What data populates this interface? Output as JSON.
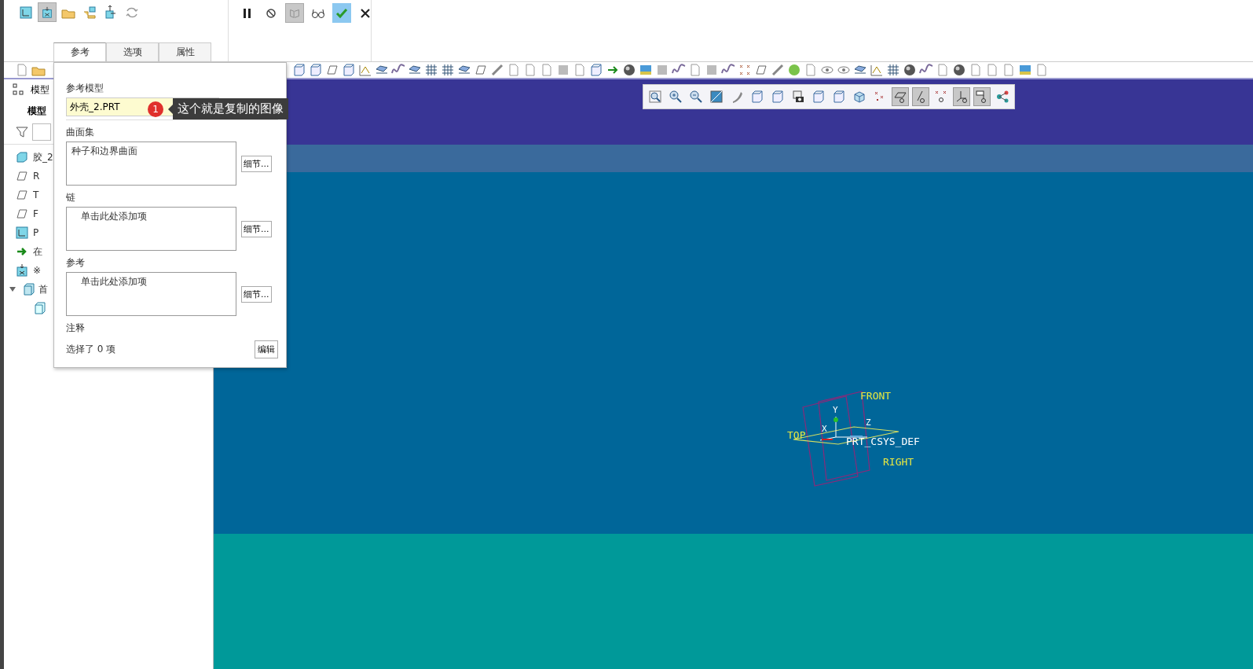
{
  "ribbon": {
    "left_buttons": [
      {
        "kind": "csys",
        "pressed": false
      },
      {
        "kind": "copy",
        "pressed": true
      },
      {
        "kind": "open",
        "pressed": false
      },
      {
        "kind": "import",
        "pressed": false
      },
      {
        "kind": "move",
        "pressed": false
      },
      {
        "kind": "swap",
        "pressed": false
      }
    ],
    "right_buttons": [
      {
        "kind": "pause",
        "pressed": false
      },
      {
        "kind": "cancel",
        "pressed": false
      },
      {
        "kind": "preview",
        "pressed": true
      },
      {
        "kind": "glasses",
        "pressed": false
      },
      {
        "kind": "ok",
        "pressed": true
      },
      {
        "kind": "close",
        "pressed": false
      }
    ],
    "tabs": [
      {
        "label": "参考",
        "selected": true
      },
      {
        "label": "选项",
        "selected": false
      },
      {
        "label": "属性",
        "selected": false
      }
    ]
  },
  "model_tree": {
    "header": "模型",
    "tab": "模型",
    "items": [
      {
        "kind": "part",
        "label": "胶_2"
      },
      {
        "kind": "plane",
        "label": "R"
      },
      {
        "kind": "plane",
        "label": "T"
      },
      {
        "kind": "plane",
        "label": "F"
      },
      {
        "kind": "csys",
        "label": "P"
      },
      {
        "kind": "insert",
        "label": "在"
      },
      {
        "kind": "copy",
        "label": "※"
      },
      {
        "kind": "feature",
        "label": "首",
        "expanded": true,
        "children": [
          {
            "kind": "quilt"
          }
        ]
      }
    ]
  },
  "reference_panel": {
    "model_label": "参考模型",
    "model_value": "外壳_2.PRT",
    "sections": [
      {
        "label": "曲面集",
        "items": [
          "种子和边界曲面"
        ],
        "button": "细节..."
      },
      {
        "label": "链",
        "placeholder": "单击此处添加项",
        "button": "细节..."
      },
      {
        "label": "参考",
        "placeholder": "单击此处添加项",
        "button": "细节..."
      }
    ],
    "note_label": "注释",
    "selection_count": "选择了 0 项",
    "edit_button": "编辑"
  },
  "tooltip": {
    "badge": "1",
    "text": "这个就是复制的图像"
  },
  "view_toolbar": [
    {
      "kind": "refit",
      "pressed": false
    },
    {
      "kind": "zoomin",
      "pressed": false
    },
    {
      "kind": "zoomout",
      "pressed": false
    },
    {
      "kind": "repaint",
      "pressed": false
    },
    {
      "kind": "style",
      "pressed": false
    },
    {
      "kind": "box",
      "pressed": false
    },
    {
      "kind": "box",
      "pressed": false
    },
    {
      "kind": "camera",
      "pressed": false
    },
    {
      "kind": "box",
      "pressed": false
    },
    {
      "kind": "box",
      "pressed": false
    },
    {
      "kind": "cube",
      "pressed": false
    },
    {
      "kind": "points",
      "pressed": false
    },
    {
      "kind": "planes",
      "pressed": true
    },
    {
      "kind": "axes",
      "pressed": true
    },
    {
      "kind": "pointdisp",
      "pressed": false
    },
    {
      "kind": "csysdisp",
      "pressed": true
    },
    {
      "kind": "annot",
      "pressed": true
    },
    {
      "kind": "spin",
      "pressed": false
    }
  ],
  "graphics": {
    "planes": [
      {
        "label": "FRONT"
      },
      {
        "label": "TOP"
      },
      {
        "label": "RIGHT"
      }
    ],
    "csys": {
      "label": "PRT_CSYS_DEF",
      "axes": [
        "X",
        "Y",
        "Z"
      ]
    }
  }
}
